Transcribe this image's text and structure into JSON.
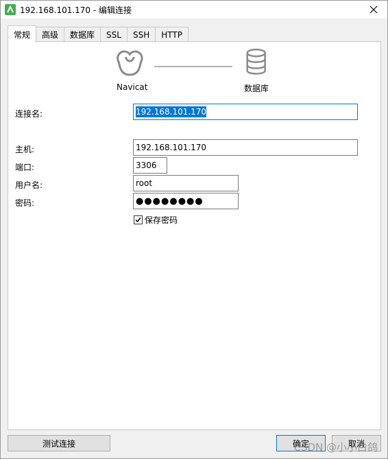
{
  "window": {
    "title": "192.168.101.170 - 编辑连接",
    "accent_color": "#0078d7"
  },
  "tabs": [
    {
      "label": "常规",
      "active": true
    },
    {
      "label": "高级",
      "active": false
    },
    {
      "label": "数据库",
      "active": false
    },
    {
      "label": "SSL",
      "active": false
    },
    {
      "label": "SSH",
      "active": false
    },
    {
      "label": "HTTP",
      "active": false
    }
  ],
  "graphic": {
    "client_label": "Navicat",
    "server_label": "数据库",
    "client_icon": "navicat-logo-icon",
    "server_icon": "database-icon"
  },
  "form": {
    "connection_name_label": "连接名:",
    "connection_name_value": "192.168.101.170",
    "host_label": "主机:",
    "host_value": "192.168.101.170",
    "port_label": "端口:",
    "port_value": "3306",
    "username_label": "用户名:",
    "username_value": "root",
    "password_label": "密码:",
    "password_value": "●●●●●●●●",
    "save_password_label": "保存密码",
    "save_password_checked": true
  },
  "buttons": {
    "test_connection": "测试连接",
    "ok": "确定",
    "cancel": "取消"
  },
  "watermark": "CSDN @小小白鸽"
}
